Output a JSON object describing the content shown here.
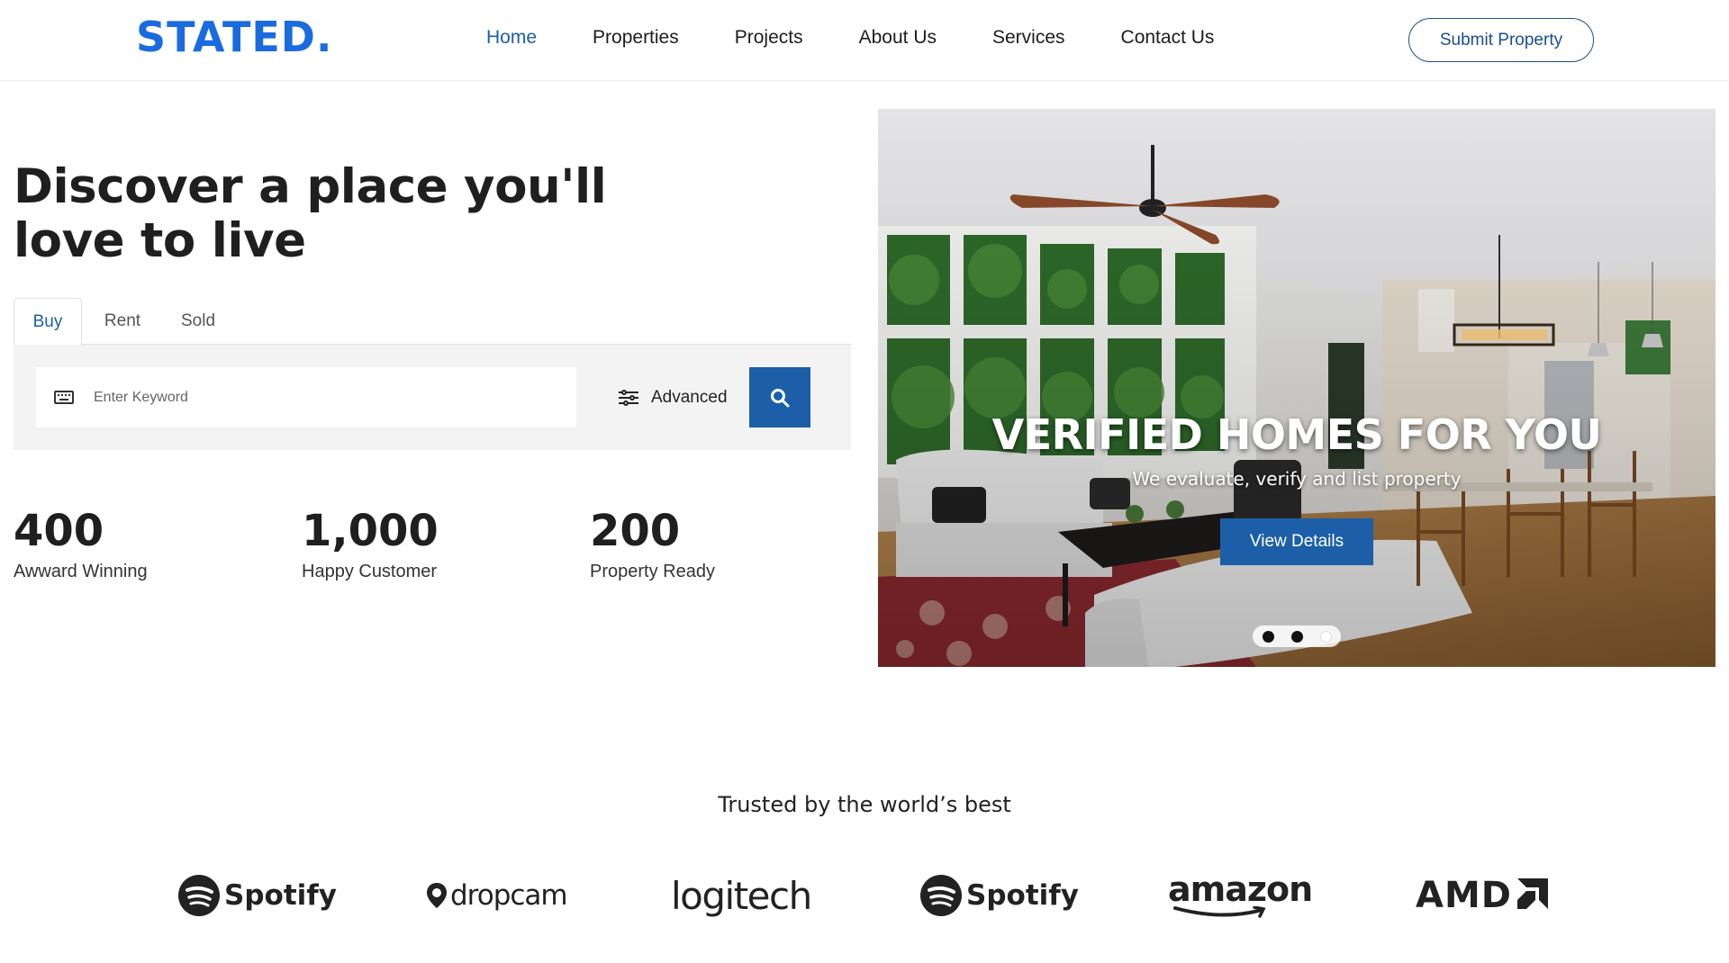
{
  "brand": {
    "logo": "STATED."
  },
  "nav": {
    "items": [
      {
        "label": "Home",
        "active": true
      },
      {
        "label": "Properties",
        "active": false
      },
      {
        "label": "Projects",
        "active": false
      },
      {
        "label": "About Us",
        "active": false
      },
      {
        "label": "Services",
        "active": false
      },
      {
        "label": "Contact Us",
        "active": false
      }
    ],
    "cta": "Submit Property"
  },
  "hero": {
    "title": "Discover a place you'll love to live",
    "tabs": [
      {
        "label": "Buy",
        "active": true
      },
      {
        "label": "Rent",
        "active": false
      },
      {
        "label": "Sold",
        "active": false
      }
    ],
    "search": {
      "placeholder": "Enter Keyword",
      "value": "",
      "advanced_label": "Advanced"
    },
    "stats": [
      {
        "value": "400",
        "label": "Awward Winning"
      },
      {
        "value": "1,000",
        "label": "Happy Customer"
      },
      {
        "value": "200",
        "label": "Property Ready"
      }
    ]
  },
  "slider": {
    "headline": "VERIFIED HOMES FOR YOU",
    "subtitle": "We evaluate, verify and list property",
    "button": "View Details",
    "slide_count": 3,
    "active_slide": 3
  },
  "trusted": {
    "title": "Trusted by the world’s best",
    "logos": [
      "Spotify",
      "dropcam",
      "logitech",
      "Spotify",
      "amazon",
      "AMD"
    ]
  },
  "colors": {
    "accent": "#1c5fa8",
    "logo": "#1a6be0",
    "search_panel": "#f3f3f3"
  },
  "icons": {
    "search_input": "keyboard-icon",
    "advanced": "sliders-icon",
    "search_button": "search-icon"
  }
}
